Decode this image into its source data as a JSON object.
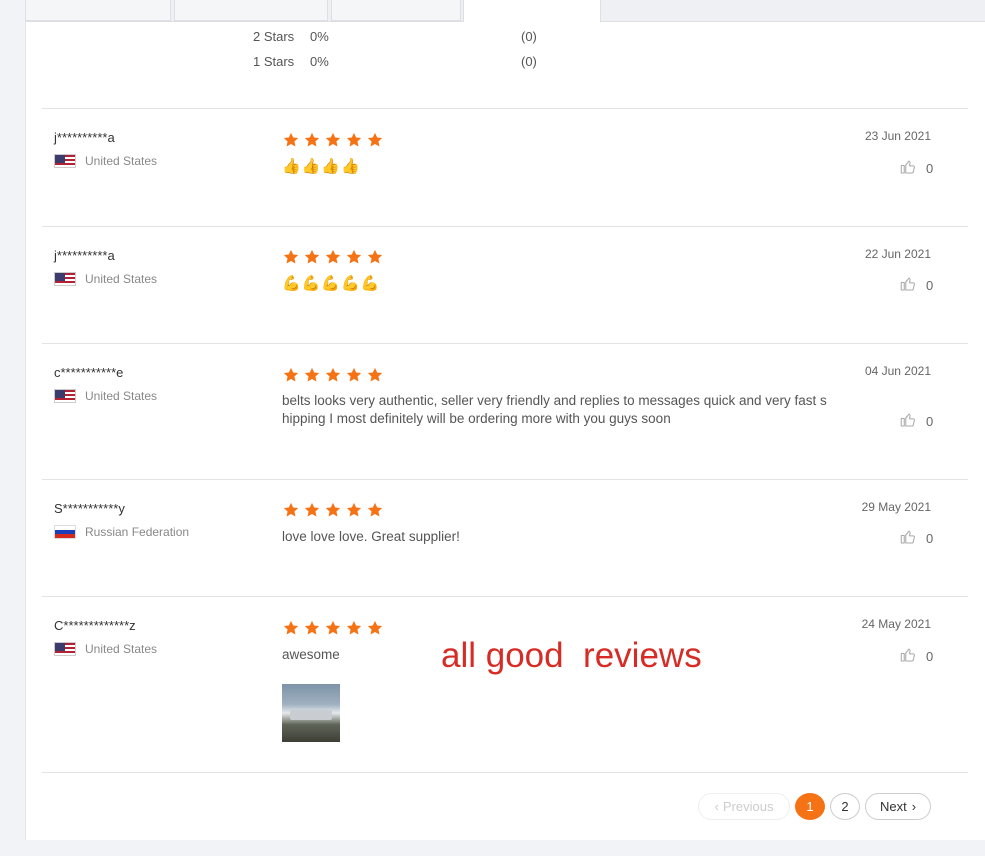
{
  "distribution": [
    {
      "label": "2 Stars",
      "percent": "0%",
      "count": "(0)"
    },
    {
      "label": "1 Stars",
      "percent": "0%",
      "count": "(0)"
    }
  ],
  "reviews": [
    {
      "user": "j**********a",
      "country": "United States",
      "flag": "us",
      "rating": 5,
      "content": "👍👍👍👍",
      "emoji": true,
      "date": "23 Jun 2021",
      "likes": "0"
    },
    {
      "user": "j**********a",
      "country": "United States",
      "flag": "us",
      "rating": 5,
      "content": "💪💪💪💪💪",
      "emoji": true,
      "date": "22 Jun 2021",
      "likes": "0"
    },
    {
      "user": "c***********e",
      "country": "United States",
      "flag": "us",
      "rating": 5,
      "content_line1": "belts looks very authentic, seller very friendly and replies to messages quick and very fast s",
      "content_line2": "hipping I most definitely will be ordering more with you guys soon",
      "date": "04 Jun 2021",
      "likes": "0"
    },
    {
      "user": "S***********y",
      "country": "Russian Federation",
      "flag": "ru",
      "rating": 5,
      "content": "love love love. Great supplier!",
      "date": "29 May 2021",
      "likes": "0"
    },
    {
      "user": "C*************z",
      "country": "United States",
      "flag": "us",
      "rating": 5,
      "content": "awesome",
      "date": "24 May 2021",
      "likes": "0",
      "has_photo": true
    }
  ],
  "overlay_text": "all good  reviews",
  "pagination": {
    "previous": "Previous",
    "pages": [
      "1",
      "2"
    ],
    "current": "1",
    "next": "Next"
  },
  "colors": {
    "star": "#f57215",
    "accent": "#f57215",
    "overlay": "#d72b25"
  }
}
